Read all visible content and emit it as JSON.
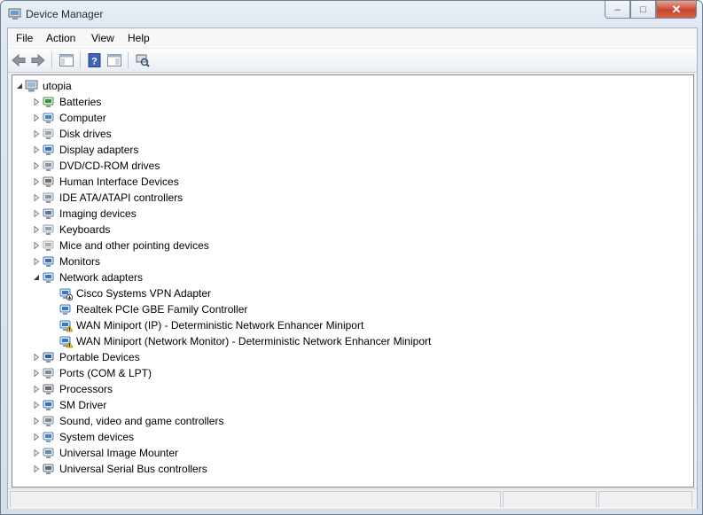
{
  "window": {
    "title": "Device Manager"
  },
  "menu": [
    "File",
    "Action",
    "View",
    "Help"
  ],
  "toolbar": [
    "back-icon",
    "forward-icon",
    "show-hide-console-tree-icon",
    "help-icon",
    "properties-icon",
    "scan-hardware-icon"
  ],
  "tree": {
    "root": "utopia",
    "categories": [
      {
        "label": "Batteries",
        "icon": "battery-icon"
      },
      {
        "label": "Computer",
        "icon": "computer-icon"
      },
      {
        "label": "Disk drives",
        "icon": "disk-drive-icon"
      },
      {
        "label": "Display adapters",
        "icon": "display-adapter-icon"
      },
      {
        "label": "DVD/CD-ROM drives",
        "icon": "dvd-drive-icon"
      },
      {
        "label": "Human Interface Devices",
        "icon": "hid-icon"
      },
      {
        "label": "IDE ATA/ATAPI controllers",
        "icon": "ide-controller-icon"
      },
      {
        "label": "Imaging devices",
        "icon": "camera-icon"
      },
      {
        "label": "Keyboards",
        "icon": "keyboard-icon"
      },
      {
        "label": "Mice and other pointing devices",
        "icon": "mouse-icon"
      },
      {
        "label": "Monitors",
        "icon": "monitor-icon"
      },
      {
        "label": "Network adapters",
        "icon": "network-adapter-icon",
        "expanded": true,
        "children": [
          {
            "label": "Cisco Systems VPN Adapter",
            "icon": "network-adapter-disabled-icon"
          },
          {
            "label": "Realtek PCIe GBE Family Controller",
            "icon": "network-adapter-icon"
          },
          {
            "label": "WAN Miniport (IP) - Deterministic Network Enhancer Miniport",
            "icon": "network-adapter-warning-icon"
          },
          {
            "label": "WAN Miniport (Network Monitor) - Deterministic Network Enhancer Miniport",
            "icon": "network-adapter-warning-icon"
          }
        ]
      },
      {
        "label": "Portable Devices",
        "icon": "portable-device-icon"
      },
      {
        "label": "Ports (COM & LPT)",
        "icon": "port-icon"
      },
      {
        "label": "Processors",
        "icon": "processor-icon"
      },
      {
        "label": "SM Driver",
        "icon": "sm-driver-icon"
      },
      {
        "label": "Sound, video and game controllers",
        "icon": "speaker-icon"
      },
      {
        "label": "System devices",
        "icon": "system-device-icon"
      },
      {
        "label": "Universal Image Mounter",
        "icon": "image-mounter-icon"
      },
      {
        "label": "Universal Serial Bus controllers",
        "icon": "usb-icon"
      }
    ]
  },
  "status": {
    "panes": [
      "",
      "",
      ""
    ]
  }
}
